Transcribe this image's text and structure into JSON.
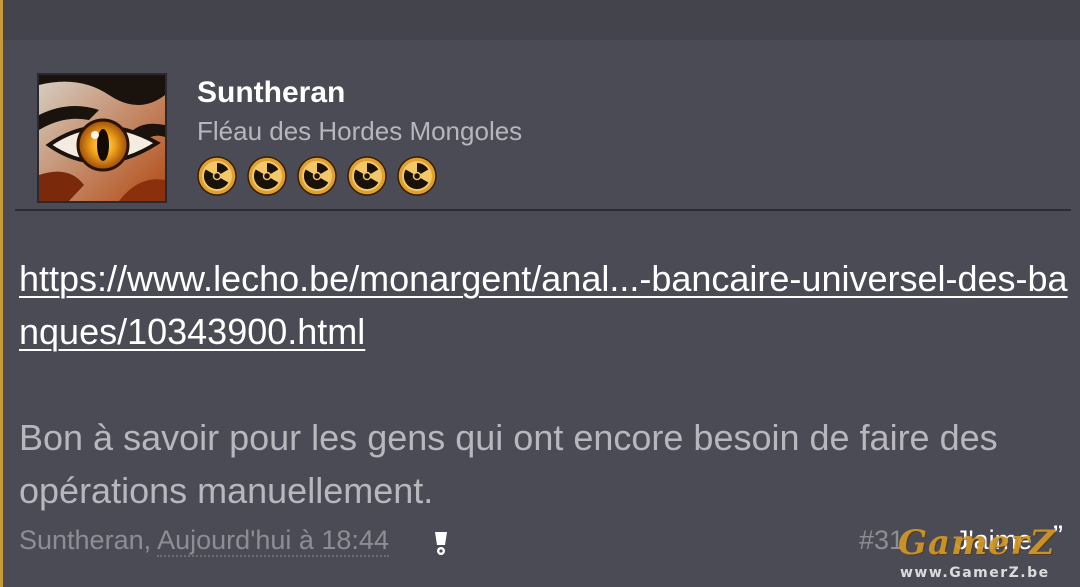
{
  "post": {
    "author": "Suntheran",
    "user_title": "Fléau des Hordes Mongoles",
    "badges": [
      "radiation-badge-icon",
      "radiation-badge-icon",
      "radiation-badge-icon",
      "radiation-badge-icon",
      "radiation-badge-icon"
    ],
    "link_text": "https://www.lecho.be/monargent/anal...-bancaire-universel-des-banques/10343900.html",
    "body_text": "Bon à savoir pour les gens qui ont encore besoin de faire des opérations manuellement.",
    "meta_author": "Suntheran,",
    "meta_date": "Aujourd'hui à 18:44",
    "post_number": "#31",
    "like_label": "J'aime",
    "quote_icon": "”"
  },
  "watermark": {
    "logo": "GamerZ",
    "url": "www.GamerZ.be"
  },
  "colors": {
    "background": "#4b4b55",
    "accent": "#c89a3a",
    "link": "#ffffff",
    "muted_text": "#8d8d93"
  }
}
